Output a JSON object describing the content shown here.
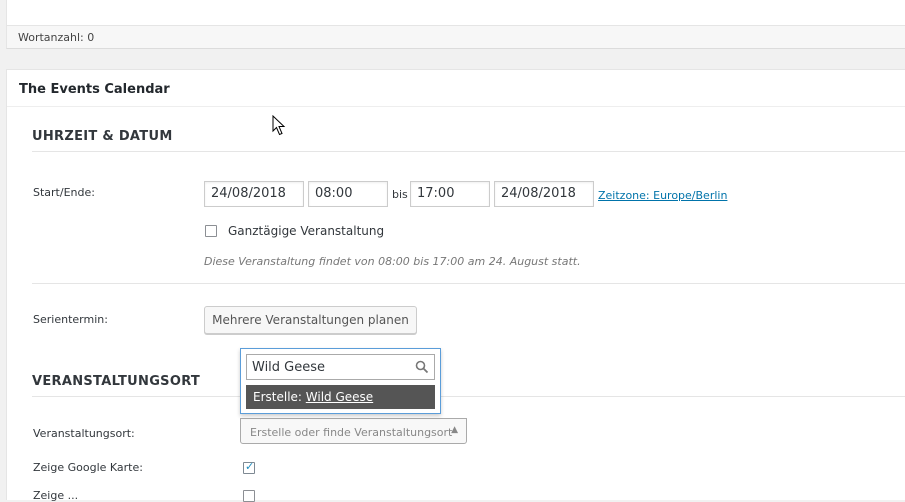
{
  "status_bar": {
    "word_count_label": "Wortanzahl:",
    "word_count_value": "0"
  },
  "panel": {
    "title": "The Events Calendar"
  },
  "datetime_section": {
    "heading": "UHRZEIT & DATUM",
    "start_end_label": "Start/Ende:",
    "start_date": "24/08/2018",
    "start_time": "08:00",
    "until_label": "bis",
    "end_time": "17:00",
    "end_date": "24/08/2018",
    "timezone_link": "Zeitzone: Europe/Berlin",
    "all_day_label": "Ganztägige Veranstaltung",
    "all_day_checked": false,
    "summary": "Diese Veranstaltung findet von 08:00 bis 17:00 am 24. August statt.",
    "recurrence_label": "Serientermin:",
    "recurrence_button": "Mehrere Veranstaltungen planen"
  },
  "venue_section": {
    "heading": "VERANSTALTUNGSORT",
    "venue_label": "Veranstaltungsort:",
    "google_map_label": "Zeige Google Karte:",
    "google_map_checked": true,
    "google_map_link_label": "Zeige ...",
    "dropdown": {
      "search_value": "Wild Geese",
      "option_prefix": "Erstelle:",
      "option_value": "Wild Geese",
      "select_placeholder": "Erstelle oder finde Veranstaltungsort"
    }
  },
  "icons": {
    "search": "search-icon",
    "arrow": "arrow-up-icon",
    "cursor": "mouse-cursor-icon"
  }
}
